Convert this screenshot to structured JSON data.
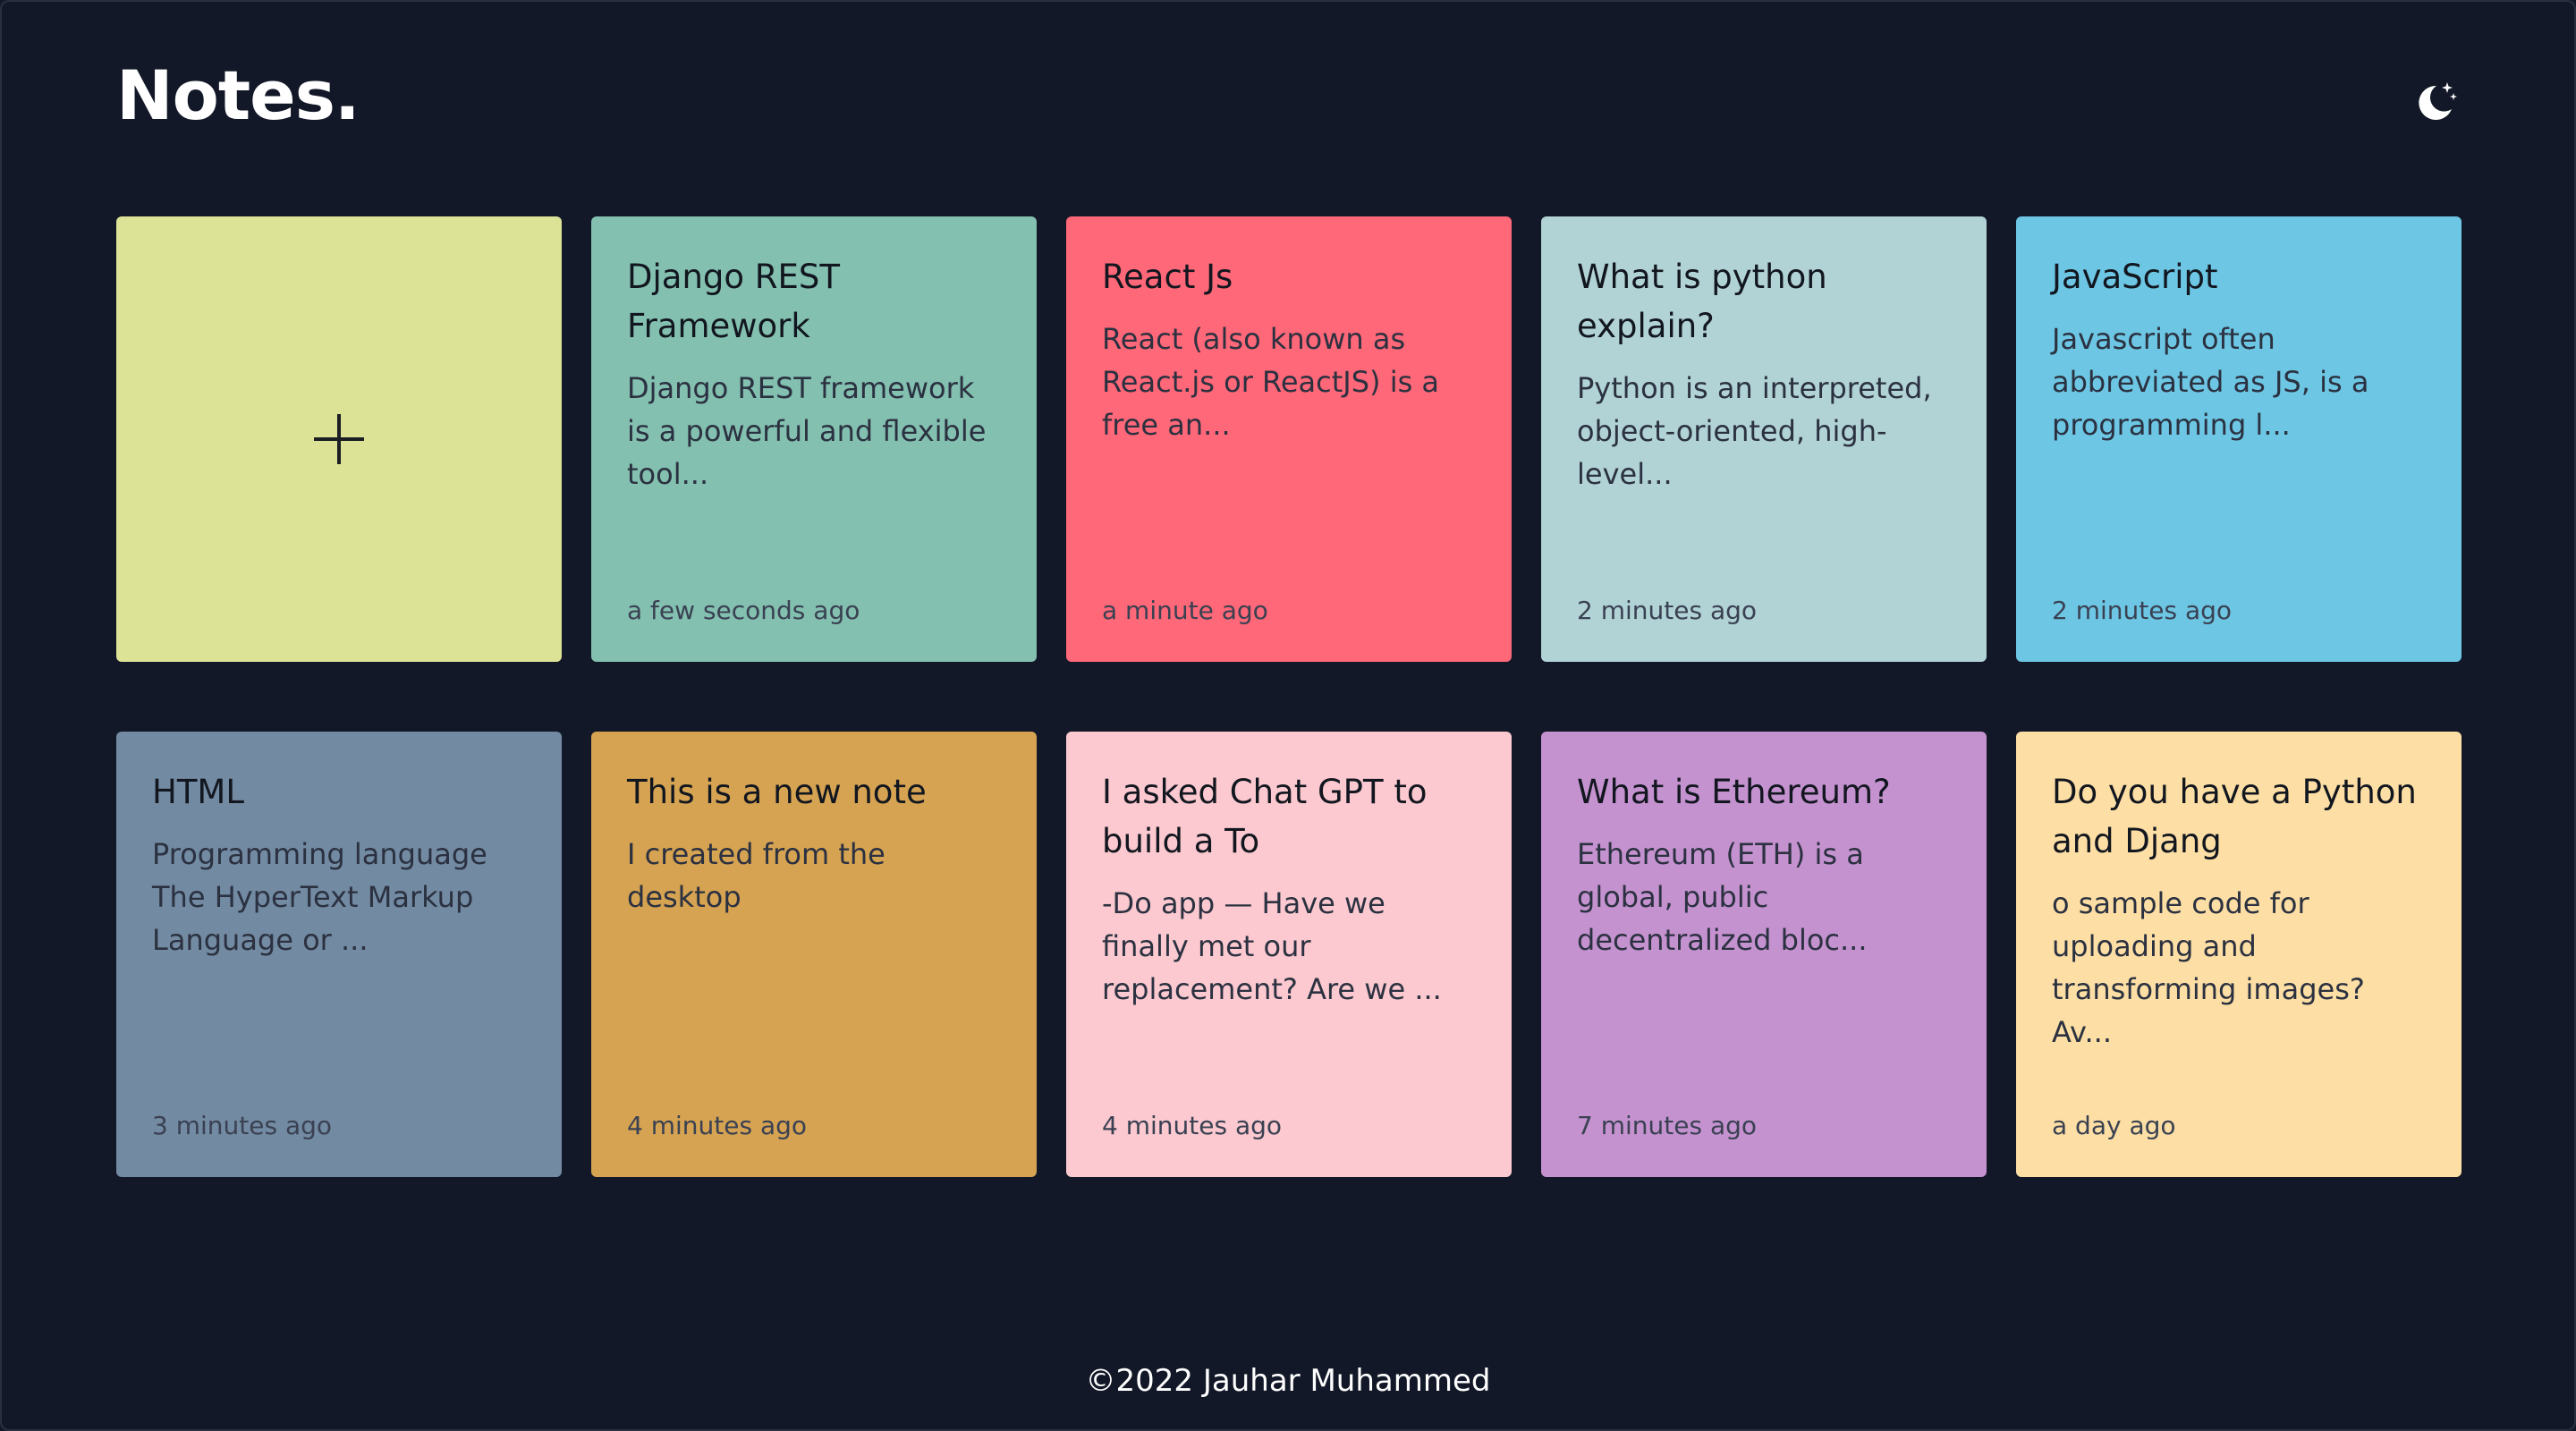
{
  "app": {
    "title": "Notes."
  },
  "header": {
    "theme_icon": "moon-stars-icon"
  },
  "add_note": {
    "icon": "plus-icon"
  },
  "notes": [
    {
      "title": "Django REST Framework",
      "body": "Django REST framework is a powerful and flexible tool...",
      "time": "a few seconds ago",
      "color": "#83c0b0"
    },
    {
      "title": "React Js",
      "body": "React (also known as React.js or ReactJS) is a free an...",
      "time": "a minute ago",
      "color": "#fe6878"
    },
    {
      "title": "What is python explain?",
      "body": "Python is an interpreted, object-oriented, high-level...",
      "time": "2 minutes ago",
      "color": "#b1d3d6"
    },
    {
      "title": "JavaScript",
      "body": "Javascript often abbreviated as JS, is a programming l...",
      "time": "2 minutes ago",
      "color": "#6dc7e4"
    },
    {
      "title": "HTML",
      "body": "Programming language The HyperText Markup Language or ...",
      "time": "3 minutes ago",
      "color": "#728aa2"
    },
    {
      "title": "This is a new note",
      "body": "I created from the desktop",
      "time": "4 minutes ago",
      "color": "#d5a352"
    },
    {
      "title": "I asked Chat GPT to build a To",
      "body": "-Do app — Have we finally met our replacement? Are we ...",
      "time": "4 minutes ago",
      "color": "#fbc9cf"
    },
    {
      "title": "What is Ethereum?",
      "body": "Ethereum (ETH) is a global, public decentralized bloc...",
      "time": "7 minutes ago",
      "color": "#c592d0"
    },
    {
      "title": "Do you have a Python and Djang",
      "body": "o sample code for uploading and transforming images? Av...",
      "time": "a day ago",
      "color": "#fddfa5"
    }
  ],
  "footer": {
    "text": "©2022 Jauhar Muhammed"
  },
  "colors": {
    "background": "#121828",
    "add_card": "#dde396"
  }
}
